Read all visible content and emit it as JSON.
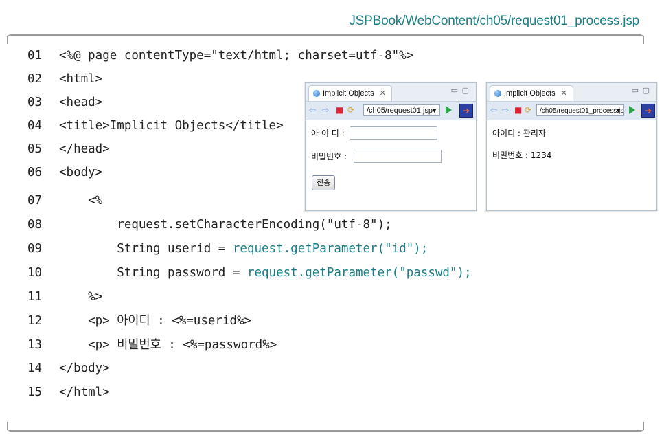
{
  "file_path": "JSPBook/WebContent/ch05/request01_process.jsp",
  "code_lines": [
    {
      "num": "01",
      "text": "<%@ page contentType=\"text/html; charset=utf-8\"%>"
    },
    {
      "num": "02",
      "text": "<html>"
    },
    {
      "num": "03",
      "text": "<head>"
    },
    {
      "num": "04",
      "text": "<title>Implicit Objects</title>"
    },
    {
      "num": "05",
      "text": "</head>"
    },
    {
      "num": "06",
      "text": "<body>"
    },
    {
      "num": "07",
      "text": "    <%"
    },
    {
      "num": "08",
      "text": "        request.setCharacterEncoding(\"utf-8\");"
    },
    {
      "num": "09",
      "text_plain": "        String userid = ",
      "text_hl": "request.getParameter(\"id\");"
    },
    {
      "num": "10",
      "text_plain": "        String password = ",
      "text_hl": "request.getParameter(\"passwd\");"
    },
    {
      "num": "11",
      "text": "    %>"
    },
    {
      "num": "12",
      "text": "    <p> 아이디 : <%=userid%>"
    },
    {
      "num": "13",
      "text": "    <p> 비밀번호 : <%=password%>"
    },
    {
      "num": "14",
      "text": "</body>"
    },
    {
      "num": "15",
      "text": "</html>"
    }
  ],
  "browser1": {
    "tab_title": "Implicit Objects",
    "url": "/ch05/request01.jsp",
    "id_label": "아 이 디 :",
    "pw_label": "비밀번호 :",
    "id_value": "",
    "pw_value": "",
    "submit_label": "전송"
  },
  "browser2": {
    "tab_title": "Implicit Objects",
    "url": "/ch05/request01_process.jsp",
    "line1": "아이디 : 관리자",
    "line2": "비밀번호 : 1234"
  },
  "colors": {
    "accent": "#1a7f86",
    "frame": "#9a9a9a"
  }
}
